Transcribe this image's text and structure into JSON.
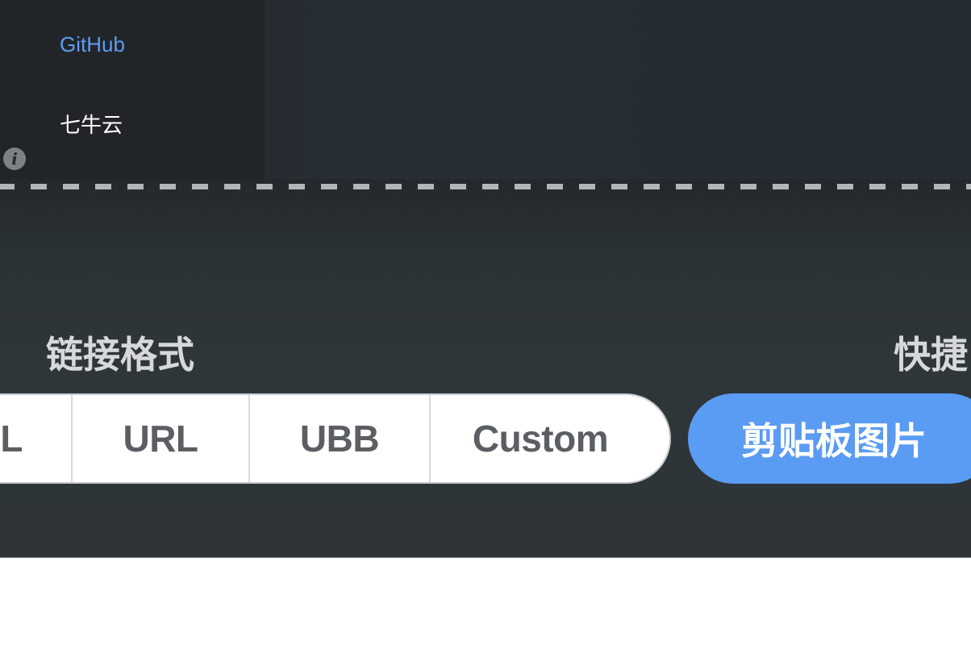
{
  "colors": {
    "sidebar_bg": "#222528",
    "content_bg": "#272d34",
    "settings_bg": "#2f3639",
    "accent": "#5a9bf3",
    "active_link": "#5c9cf5",
    "text_light": "#ffffff",
    "segment_text": "#5b5f63"
  },
  "sidebar": {
    "items": [
      {
        "label": "GitHub",
        "active": true,
        "color": "#5c9cf5"
      },
      {
        "label": "七牛云",
        "active": false,
        "color": "#ffffff"
      }
    ],
    "info_icon": {
      "icon": "info-icon",
      "glyph": "i"
    }
  },
  "settings": {
    "link_format_label": "链接格式",
    "shortcut_label": "快捷",
    "link_formats": [
      {
        "label": "L",
        "selected": false
      },
      {
        "label": "URL",
        "selected": false
      },
      {
        "label": "UBB",
        "selected": false
      },
      {
        "label": "Custom",
        "selected": false
      }
    ],
    "clipboard_button_label": "剪贴板图片"
  }
}
